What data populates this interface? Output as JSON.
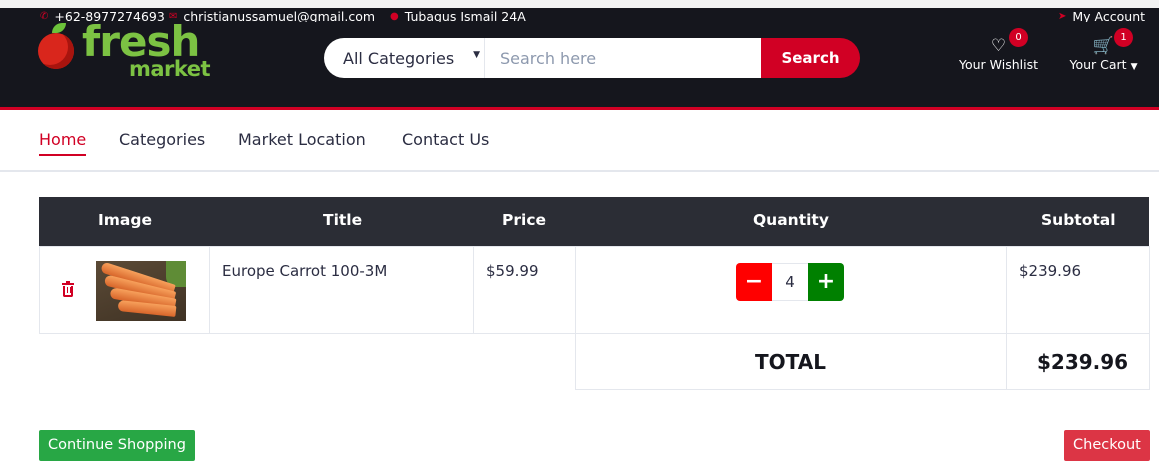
{
  "colors": {
    "header_bg": "#15161d",
    "accent": "#d10024",
    "table_header_bg": "#2b2d35",
    "minus_button": "#ff0000",
    "plus_button": "#008000",
    "continue_button": "#28a745",
    "checkout_button": "#dc3545",
    "logo_green": "#7cc243"
  },
  "topbar": {
    "phone": "+62-8977274693",
    "email": "christianussamuel@gmail.com",
    "address": "Tubagus Ismail 24A",
    "account": "My Account",
    "icons": [
      "phone-icon",
      "envelope-icon",
      "map-marker-icon",
      "sign-in-icon"
    ]
  },
  "logo": {
    "line1": "fresh",
    "line2": "market"
  },
  "search": {
    "category_selected": "All Categories",
    "placeholder": "Search here",
    "button_label": "Search"
  },
  "header": {
    "wishlist_label": "Your Wishlist",
    "wishlist_count": "0",
    "cart_label": "Your Cart",
    "cart_count": "1",
    "icons": [
      "heart-icon",
      "shopping-cart-icon",
      "caret-down-icon"
    ]
  },
  "nav": {
    "items": [
      {
        "label": "Home",
        "active": true
      },
      {
        "label": "Categories",
        "active": false
      },
      {
        "label": "Market Location",
        "active": false
      },
      {
        "label": "Contact Us",
        "active": false
      }
    ]
  },
  "cart": {
    "columns": [
      "Image",
      "Title",
      "Price",
      "Quantity",
      "Subtotal"
    ],
    "rows": [
      {
        "image": "carrots-photo",
        "title": "Europe Carrot 100-3M",
        "price": "$59.99",
        "quantity": "4",
        "subtotal": "$239.96"
      }
    ],
    "total_label": "TOTAL",
    "total_value": "$239.96",
    "minus_symbol": "−",
    "plus_symbol": "+"
  },
  "actions": {
    "continue_label": "Continue Shopping",
    "checkout_label": "Checkout"
  }
}
